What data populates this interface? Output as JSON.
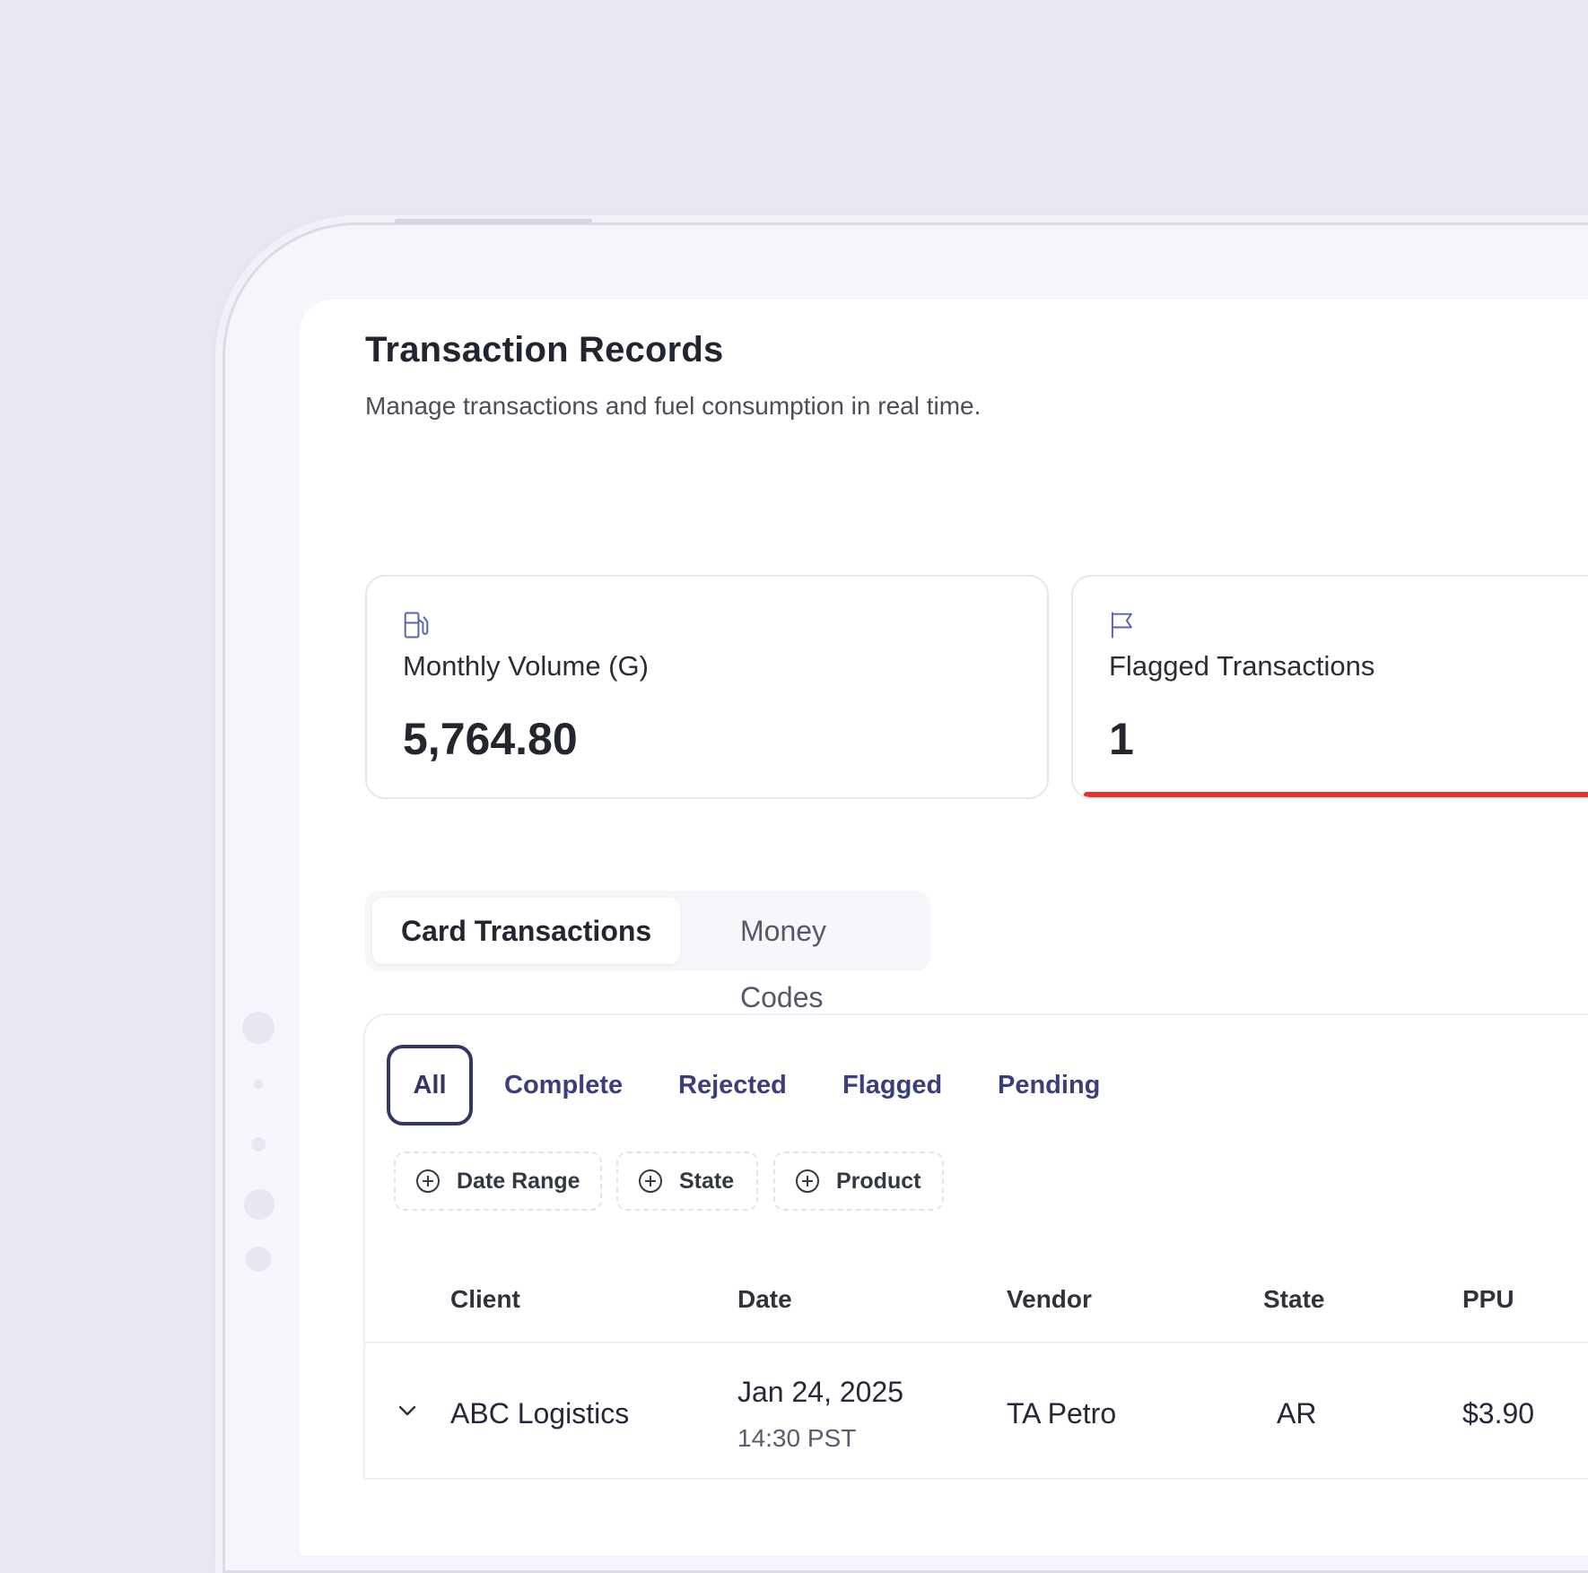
{
  "header": {
    "title": "Transaction Records",
    "subtitle": "Manage transactions and fuel consumption in real time."
  },
  "stats": [
    {
      "icon": "fuel-pump-icon",
      "label": "Monthly Volume (G)",
      "value": "5,764.80"
    },
    {
      "icon": "flag-icon",
      "label": "Flagged Transactions",
      "value": "1",
      "accent": "#e5322d"
    }
  ],
  "tabs": [
    {
      "label": "Card Transactions",
      "active": true
    },
    {
      "label": "Money Codes",
      "active": false
    }
  ],
  "status_filters": [
    {
      "label": "All",
      "active": true
    },
    {
      "label": "Complete",
      "active": false
    },
    {
      "label": "Rejected",
      "active": false
    },
    {
      "label": "Flagged",
      "active": false
    },
    {
      "label": "Pending",
      "active": false
    }
  ],
  "filter_chips": [
    {
      "label": "Date Range",
      "icon": "plus-circle-icon"
    },
    {
      "label": "State",
      "icon": "plus-circle-icon"
    },
    {
      "label": "Product",
      "icon": "plus-circle-icon"
    }
  ],
  "table": {
    "columns": [
      "Client",
      "Date",
      "Vendor",
      "State",
      "PPU"
    ],
    "rows": [
      {
        "client": "ABC Logistics",
        "date": "Jan 24, 2025",
        "time": "14:30 PST",
        "vendor": "TA Petro",
        "state": "AR",
        "ppu": "$3.90"
      }
    ]
  },
  "colors": {
    "brand": "#333766",
    "flag_accent": "#e5322d",
    "background": "#e8e8f3"
  }
}
